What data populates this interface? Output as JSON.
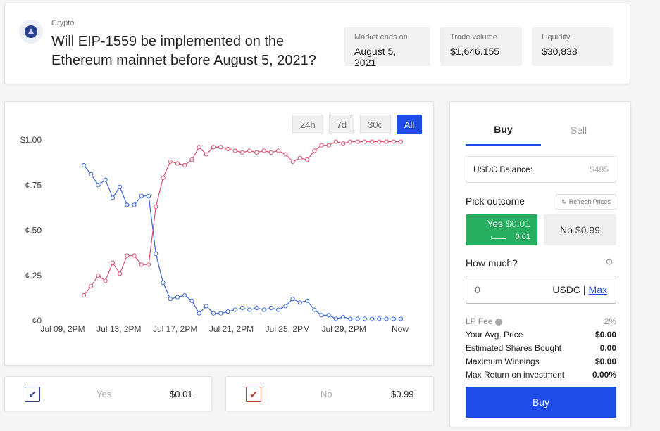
{
  "header": {
    "category": "Crypto",
    "question": "Will EIP-1559 be implemented on the Ethereum mainnet before August 5, 2021?",
    "stats": [
      {
        "label": "Market ends on",
        "value": "August 5, 2021"
      },
      {
        "label": "Trade volume",
        "value": "$1,646,155"
      },
      {
        "label": "Liquidity",
        "value": "$30,838"
      }
    ]
  },
  "chart": {
    "ranges": [
      "24h",
      "7d",
      "30d",
      "All"
    ],
    "active_range": "All"
  },
  "chart_data": {
    "type": "line",
    "y_tick_labels": [
      "$1.00",
      "¢.75",
      "¢.50",
      "¢.25",
      "¢0"
    ],
    "x_tick_labels": [
      "Jul 09, 2PM",
      "Jul 13, 2PM",
      "Jul 17, 2PM",
      "Jul 21, 2PM",
      "Jul 25, 2PM",
      "Jul 29, 2PM",
      "Now"
    ],
    "ylim": [
      0,
      1
    ],
    "grid": false,
    "colors": {
      "Yes": "#3a66d6",
      "No": "#d94f6e"
    },
    "series": [
      {
        "name": "Yes",
        "values": [
          0.86,
          0.81,
          0.75,
          0.78,
          0.68,
          0.74,
          0.64,
          0.64,
          0.69,
          0.69,
          0.37,
          0.21,
          0.12,
          0.13,
          0.14,
          0.11,
          0.04,
          0.08,
          0.04,
          0.04,
          0.05,
          0.06,
          0.07,
          0.06,
          0.07,
          0.06,
          0.07,
          0.06,
          0.08,
          0.12,
          0.1,
          0.11,
          0.06,
          0.03,
          0.03,
          0.01,
          0.02,
          0.01,
          0.01,
          0.01,
          0.01,
          0.01,
          0.01,
          0.01,
          0.01
        ]
      },
      {
        "name": "No",
        "values": [
          0.14,
          0.19,
          0.25,
          0.22,
          0.32,
          0.26,
          0.36,
          0.36,
          0.31,
          0.31,
          0.63,
          0.79,
          0.88,
          0.87,
          0.86,
          0.89,
          0.96,
          0.92,
          0.96,
          0.96,
          0.95,
          0.94,
          0.93,
          0.94,
          0.93,
          0.94,
          0.93,
          0.94,
          0.92,
          0.88,
          0.9,
          0.89,
          0.94,
          0.97,
          0.97,
          0.99,
          0.98,
          0.99,
          0.99,
          0.99,
          0.99,
          0.99,
          0.99,
          0.99,
          0.99
        ]
      }
    ]
  },
  "outcomes": [
    {
      "name": "Yes",
      "price": "$0.01",
      "check": "✔",
      "color": "#2b3f8f"
    },
    {
      "name": "No",
      "price": "$0.99",
      "check": "✔",
      "color": "#c0392b"
    }
  ],
  "trade": {
    "tabs": [
      "Buy",
      "Sell"
    ],
    "active_tab": "Buy",
    "balance_label": "USDC Balance:",
    "balance_value": "$485",
    "pick_outcome_label": "Pick outcome",
    "refresh_label": "Refresh Prices",
    "yes_label": "Yes",
    "yes_price": "$0.01",
    "yes_sub": "0.01",
    "no_label": "No",
    "no_price": "$0.99",
    "how_much_label": "How much?",
    "amount_placeholder": "0",
    "unit": "USDC |",
    "max_label": "Max",
    "lp_fee_label": "LP Fee",
    "lp_fee_value": "2%",
    "rows": [
      {
        "label": "Your Avg. Price",
        "value": "$0.00"
      },
      {
        "label": "Estimated Shares Bought",
        "value": "0.00"
      },
      {
        "label": "Maximum Winnings",
        "value": "$0.00"
      },
      {
        "label": "Max Return on investment",
        "value": "0.00%"
      }
    ],
    "buy_button": "Buy"
  },
  "icons": {
    "logo": "ethereum-logo-icon",
    "refresh": "refresh-icon",
    "gear": "gear-icon",
    "info": "info-icon"
  }
}
